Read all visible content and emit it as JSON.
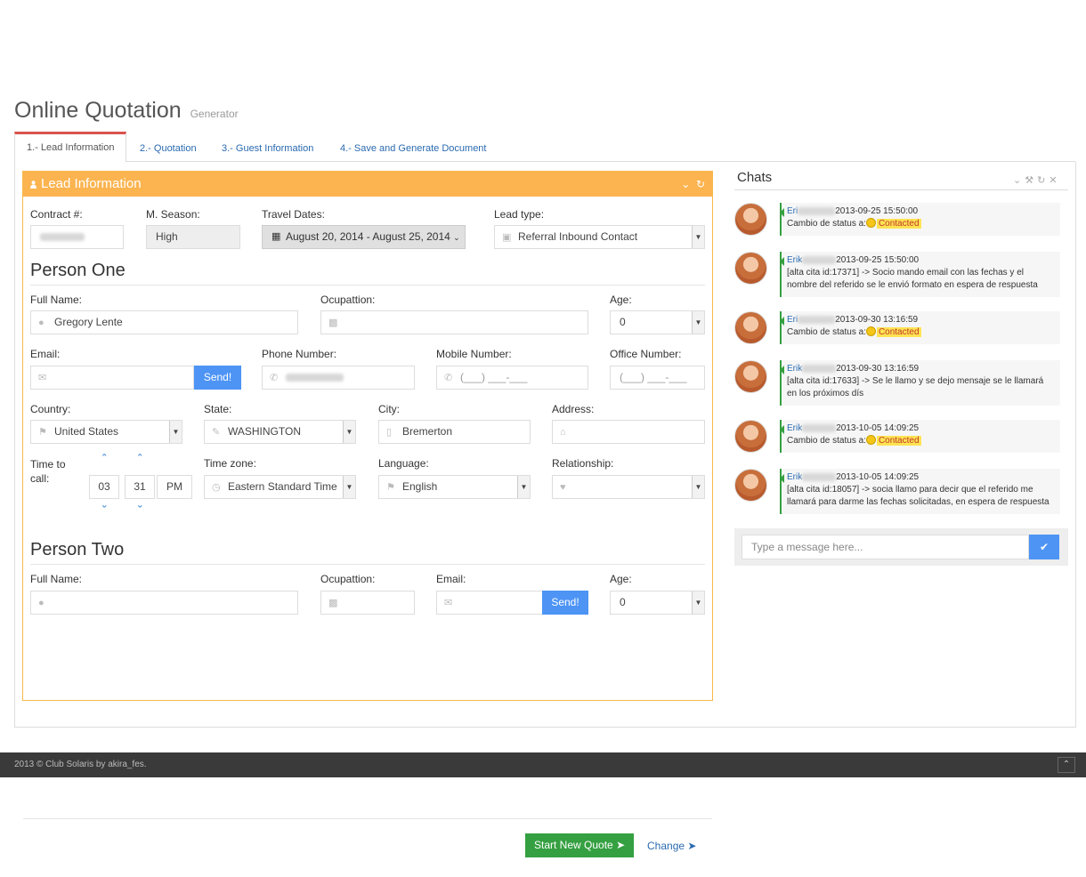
{
  "page": {
    "title": "Online Quotation",
    "subtitle": "Generator"
  },
  "tabs": [
    {
      "label": "1.- Lead Information",
      "active": true
    },
    {
      "label": "2.- Quotation",
      "active": false
    },
    {
      "label": "3.- Guest Information",
      "active": false
    },
    {
      "label": "4.- Save and Generate Document",
      "active": false
    }
  ],
  "panel": {
    "title": "Lead Information"
  },
  "lead": {
    "contract_label": "Contract #:",
    "season_label": "M. Season:",
    "season_value": "High",
    "travel_label": "Travel Dates:",
    "travel_value": "August 20, 2014 - August 25, 2014",
    "leadtype_label": "Lead type:",
    "leadtype_value": "Referral Inbound Contact"
  },
  "person_one": {
    "heading": "Person One",
    "fullname_label": "Full Name:",
    "fullname_value": "Gregory Lente",
    "occupation_label": "Ocupattion:",
    "age_label": "Age:",
    "age_value": "0",
    "email_label": "Email:",
    "send_label": "Send!",
    "phone_label": "Phone Number:",
    "mobile_label": "Mobile Number:",
    "mobile_placeholder": "(___) ___-___",
    "office_label": "Office Number:",
    "office_placeholder": "(___) ___-___",
    "country_label": "Country:",
    "country_value": "United States",
    "state_label": "State:",
    "state_value": "WASHINGTON",
    "city_label": "City:",
    "city_value": "Bremerton",
    "address_label": "Address:",
    "time_label": "Time to call:",
    "hour": "03",
    "minute": "31",
    "meridian": "PM",
    "timezone_label": "Time zone:",
    "timezone_value": "Eastern Standard Time",
    "language_label": "Language:",
    "language_value": "English",
    "relationship_label": "Relationship:"
  },
  "person_two": {
    "heading": "Person Two",
    "fullname_label": "Full Name:",
    "occupation_label": "Ocupattion:",
    "email_label": "Email:",
    "send_label": "Send!",
    "age_label": "Age:",
    "age_value": "0"
  },
  "actions": {
    "start_label": "Start New Quote",
    "change_label": "Change"
  },
  "chats": {
    "title": "Chats",
    "placeholder": "Type a message here...",
    "messages": [
      {
        "name": "Eri",
        "time": "2013-09-25 15:50:00",
        "text": "Cambio de status a:",
        "tag": "Contacted"
      },
      {
        "name": "Erik",
        "time": "2013-09-25 15:50:00",
        "text": "[alta cita id:17371] -> Socio mando email con las fechas y el nombre del referido se le envió formato en espera de respuesta"
      },
      {
        "name": "Eri",
        "time": "2013-09-30 13:16:59",
        "text": "Cambio de status a:",
        "tag": "Contacted"
      },
      {
        "name": "Erik",
        "time": "2013-09-30 13:16:59",
        "text": "[alta cita id:17633] -> Se le llamo y se dejo mensaje se le llamará en los próximos dís"
      },
      {
        "name": "Erik",
        "time": "2013-10-05 14:09:25",
        "text": "Cambio de status a:",
        "tag": "Contacted"
      },
      {
        "name": "Erik",
        "time": "2013-10-05 14:09:25",
        "text": "[alta cita id:18057] -> socia llamo para decir que el referido me llamará para darme las fechas solicitadas, en espera de respuesta"
      }
    ]
  },
  "footer": {
    "text": "2013 © Club Solaris by akira_fes."
  },
  "colors": {
    "accent": "#fbb450",
    "primary": "#4d94f5",
    "success": "#35a041",
    "danger": "#d9534f"
  }
}
